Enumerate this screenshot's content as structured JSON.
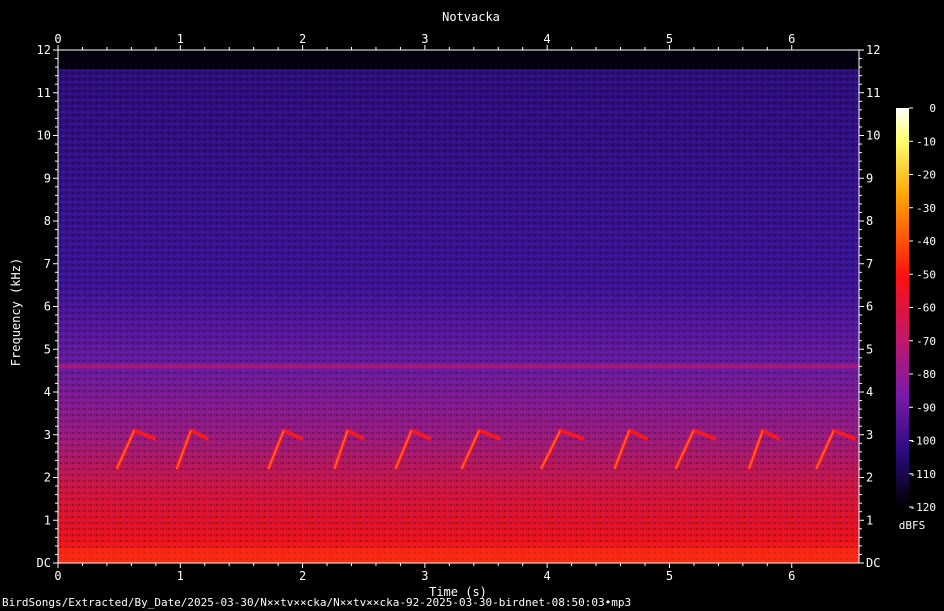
{
  "chart_data": {
    "type": "heatmap",
    "title": "Notvacka",
    "xlabel": "Time (s)",
    "ylabel": "Frequency (kHz)",
    "xlim": [
      0,
      6.55
    ],
    "ylim": [
      0,
      12
    ],
    "x_ticks": [
      "0",
      "1",
      "2",
      "3",
      "4",
      "5",
      "6"
    ],
    "y_ticks": [
      "DC",
      "1",
      "2",
      "3",
      "4",
      "5",
      "6",
      "7",
      "8",
      "9",
      "10",
      "11",
      "12"
    ],
    "colorbar": {
      "label": "dBFS",
      "range": [
        -120,
        0
      ],
      "ticks": [
        "0",
        "-10",
        "-20",
        "-30",
        "-40",
        "-50",
        "-60",
        "-70",
        "-80",
        "-90",
        "-100",
        "-110",
        "-120"
      ]
    },
    "calls": [
      {
        "start": 0.48,
        "end": 0.8
      },
      {
        "start": 0.97,
        "end": 1.23
      },
      {
        "start": 1.72,
        "end": 2.0
      },
      {
        "start": 2.26,
        "end": 2.5
      },
      {
        "start": 2.76,
        "end": 3.05
      },
      {
        "start": 3.3,
        "end": 3.62
      },
      {
        "start": 3.95,
        "end": 4.3
      },
      {
        "start": 4.55,
        "end": 4.82
      },
      {
        "start": 5.05,
        "end": 5.38
      },
      {
        "start": 5.65,
        "end": 5.9
      },
      {
        "start": 6.2,
        "end": 6.52
      }
    ],
    "tone_khz": 4.6
  },
  "footer": {
    "path": "BirdSongs/Extracted/By_Date/2025-03-30/N××tv××cka/N××tv××cka-92-2025-03-30-birdnet-08:50:03•mp3"
  }
}
